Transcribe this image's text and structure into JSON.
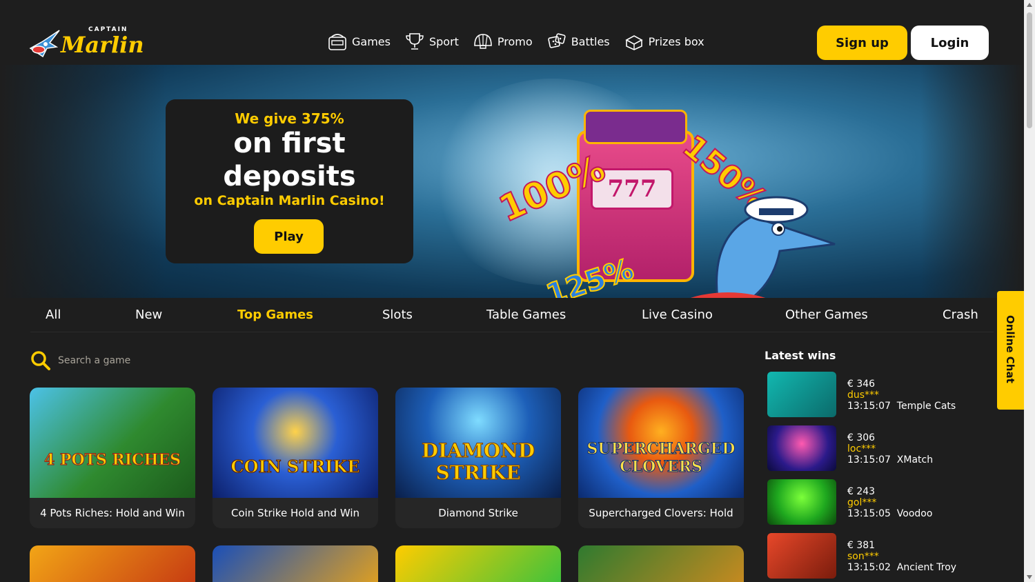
{
  "header": {
    "logo_small": "CAPTAIN",
    "logo_big": "Marlin",
    "nav": [
      {
        "label": "Games",
        "icon": "slot-machine-icon"
      },
      {
        "label": "Sport",
        "icon": "trophy-icon"
      },
      {
        "label": "Promo",
        "icon": "shell-icon"
      },
      {
        "label": "Battles",
        "icon": "dice-icon"
      },
      {
        "label": "Prizes box",
        "icon": "treasure-chest-icon"
      }
    ],
    "signup_label": "Sign up",
    "login_label": "Login"
  },
  "hero": {
    "line1": "We give 375%",
    "line2": "on first deposits",
    "line3": "on Captain Marlin Casino!",
    "play_label": "Play",
    "badge_a": "100%",
    "badge_b": "150%",
    "badge_c": "125%",
    "slot_text": "777",
    "slides": 4,
    "active_slide": 1
  },
  "categories": [
    {
      "label": "All"
    },
    {
      "label": "New"
    },
    {
      "label": "Top Games",
      "active": true
    },
    {
      "label": "Slots"
    },
    {
      "label": "Table Games"
    },
    {
      "label": "Live Casino"
    },
    {
      "label": "Other Games"
    },
    {
      "label": "Crash"
    }
  ],
  "online_chat": "Online Chat",
  "search": {
    "placeholder": "Search a game"
  },
  "games": [
    {
      "title": "4 Pots Riches: Hold and Win",
      "art": "4 POTS RICHES"
    },
    {
      "title": "Coin Strike Hold and Win",
      "art": "COIN STRIKE"
    },
    {
      "title": "Diamond Strike",
      "art": "DIAMOND STRIKE"
    },
    {
      "title": "Supercharged Clovers: Hold",
      "art": "SUPERCHARGED CLOVERS"
    }
  ],
  "latest_wins": {
    "title": "Latest wins",
    "items": [
      {
        "amount": "€ 346",
        "user": "dus***",
        "time": "13:15:07",
        "game": "Temple Cats"
      },
      {
        "amount": "€ 306",
        "user": "loc***",
        "time": "13:15:07",
        "game": "XMatch"
      },
      {
        "amount": "€ 243",
        "user": "gol***",
        "time": "13:15:05",
        "game": "Voodoo"
      },
      {
        "amount": "€ 381",
        "user": "son***",
        "time": "13:15:02",
        "game": "Ancient Troy"
      }
    ]
  },
  "colors": {
    "accent": "#ffcc00",
    "background": "#1e1e1e"
  }
}
